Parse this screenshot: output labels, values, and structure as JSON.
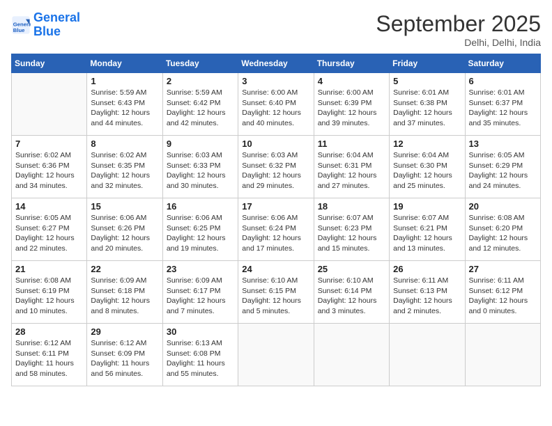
{
  "header": {
    "logo_line1": "General",
    "logo_line2": "Blue",
    "month": "September 2025",
    "location": "Delhi, Delhi, India"
  },
  "weekdays": [
    "Sunday",
    "Monday",
    "Tuesday",
    "Wednesday",
    "Thursday",
    "Friday",
    "Saturday"
  ],
  "weeks": [
    [
      {
        "day": "",
        "info": ""
      },
      {
        "day": "1",
        "info": "Sunrise: 5:59 AM\nSunset: 6:43 PM\nDaylight: 12 hours\nand 44 minutes."
      },
      {
        "day": "2",
        "info": "Sunrise: 5:59 AM\nSunset: 6:42 PM\nDaylight: 12 hours\nand 42 minutes."
      },
      {
        "day": "3",
        "info": "Sunrise: 6:00 AM\nSunset: 6:40 PM\nDaylight: 12 hours\nand 40 minutes."
      },
      {
        "day": "4",
        "info": "Sunrise: 6:00 AM\nSunset: 6:39 PM\nDaylight: 12 hours\nand 39 minutes."
      },
      {
        "day": "5",
        "info": "Sunrise: 6:01 AM\nSunset: 6:38 PM\nDaylight: 12 hours\nand 37 minutes."
      },
      {
        "day": "6",
        "info": "Sunrise: 6:01 AM\nSunset: 6:37 PM\nDaylight: 12 hours\nand 35 minutes."
      }
    ],
    [
      {
        "day": "7",
        "info": "Sunrise: 6:02 AM\nSunset: 6:36 PM\nDaylight: 12 hours\nand 34 minutes."
      },
      {
        "day": "8",
        "info": "Sunrise: 6:02 AM\nSunset: 6:35 PM\nDaylight: 12 hours\nand 32 minutes."
      },
      {
        "day": "9",
        "info": "Sunrise: 6:03 AM\nSunset: 6:33 PM\nDaylight: 12 hours\nand 30 minutes."
      },
      {
        "day": "10",
        "info": "Sunrise: 6:03 AM\nSunset: 6:32 PM\nDaylight: 12 hours\nand 29 minutes."
      },
      {
        "day": "11",
        "info": "Sunrise: 6:04 AM\nSunset: 6:31 PM\nDaylight: 12 hours\nand 27 minutes."
      },
      {
        "day": "12",
        "info": "Sunrise: 6:04 AM\nSunset: 6:30 PM\nDaylight: 12 hours\nand 25 minutes."
      },
      {
        "day": "13",
        "info": "Sunrise: 6:05 AM\nSunset: 6:29 PM\nDaylight: 12 hours\nand 24 minutes."
      }
    ],
    [
      {
        "day": "14",
        "info": "Sunrise: 6:05 AM\nSunset: 6:27 PM\nDaylight: 12 hours\nand 22 minutes."
      },
      {
        "day": "15",
        "info": "Sunrise: 6:06 AM\nSunset: 6:26 PM\nDaylight: 12 hours\nand 20 minutes."
      },
      {
        "day": "16",
        "info": "Sunrise: 6:06 AM\nSunset: 6:25 PM\nDaylight: 12 hours\nand 19 minutes."
      },
      {
        "day": "17",
        "info": "Sunrise: 6:06 AM\nSunset: 6:24 PM\nDaylight: 12 hours\nand 17 minutes."
      },
      {
        "day": "18",
        "info": "Sunrise: 6:07 AM\nSunset: 6:23 PM\nDaylight: 12 hours\nand 15 minutes."
      },
      {
        "day": "19",
        "info": "Sunrise: 6:07 AM\nSunset: 6:21 PM\nDaylight: 12 hours\nand 13 minutes."
      },
      {
        "day": "20",
        "info": "Sunrise: 6:08 AM\nSunset: 6:20 PM\nDaylight: 12 hours\nand 12 minutes."
      }
    ],
    [
      {
        "day": "21",
        "info": "Sunrise: 6:08 AM\nSunset: 6:19 PM\nDaylight: 12 hours\nand 10 minutes."
      },
      {
        "day": "22",
        "info": "Sunrise: 6:09 AM\nSunset: 6:18 PM\nDaylight: 12 hours\nand 8 minutes."
      },
      {
        "day": "23",
        "info": "Sunrise: 6:09 AM\nSunset: 6:17 PM\nDaylight: 12 hours\nand 7 minutes."
      },
      {
        "day": "24",
        "info": "Sunrise: 6:10 AM\nSunset: 6:15 PM\nDaylight: 12 hours\nand 5 minutes."
      },
      {
        "day": "25",
        "info": "Sunrise: 6:10 AM\nSunset: 6:14 PM\nDaylight: 12 hours\nand 3 minutes."
      },
      {
        "day": "26",
        "info": "Sunrise: 6:11 AM\nSunset: 6:13 PM\nDaylight: 12 hours\nand 2 minutes."
      },
      {
        "day": "27",
        "info": "Sunrise: 6:11 AM\nSunset: 6:12 PM\nDaylight: 12 hours\nand 0 minutes."
      }
    ],
    [
      {
        "day": "28",
        "info": "Sunrise: 6:12 AM\nSunset: 6:11 PM\nDaylight: 11 hours\nand 58 minutes."
      },
      {
        "day": "29",
        "info": "Sunrise: 6:12 AM\nSunset: 6:09 PM\nDaylight: 11 hours\nand 56 minutes."
      },
      {
        "day": "30",
        "info": "Sunrise: 6:13 AM\nSunset: 6:08 PM\nDaylight: 11 hours\nand 55 minutes."
      },
      {
        "day": "",
        "info": ""
      },
      {
        "day": "",
        "info": ""
      },
      {
        "day": "",
        "info": ""
      },
      {
        "day": "",
        "info": ""
      }
    ]
  ]
}
